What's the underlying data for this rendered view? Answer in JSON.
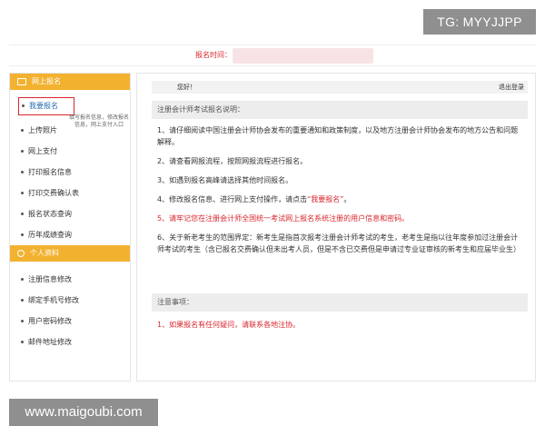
{
  "watermarks": {
    "top": "TG: MYYJJPP",
    "bottom": "www.maigoubi.com"
  },
  "header": {
    "registration_time_label": "报名时间："
  },
  "sidebar": {
    "section1": "网上报名",
    "items": [
      "我要报名",
      "上传照片",
      "网上支付",
      "打印报名信息",
      "打印交费确认表",
      "报名状态查询",
      "历年成绩查询"
    ],
    "tooltip": "填写报名信息，修改报名信息，网上支付入口",
    "section2": "个人资料",
    "items2": [
      "注册信息修改",
      "绑定手机号修改",
      "用户密码修改",
      "邮件地址修改"
    ]
  },
  "content": {
    "greeting": "您好！",
    "logout": "退出登录",
    "notice_title": "注册会计师考试报名说明：",
    "notices": [
      "1、请仔细阅读中国注册会计师协会发布的重要通知和政策制度，以及地方注册会计师协会发布的地方公告和问题解释。",
      "2、请查看网报流程，按照网报流程进行报名。",
      "3、如遇到报名高峰请选择其他时间报名。",
      "4、修改报名信息、进行网上支付操作，请点击",
      "5、请牢记您在注册会计师全国统一考试网上报名系统注册的用户信息和密码。",
      "6、关于新老考生的范围界定：新考生是指首次报考注册会计师考试的考生，老考生是指以往年度参加过注册会计师考试的考生（含已报名交费确认但未出考人员，但是不含已交费但是申请过专业证审核的新考生和应届毕业生）"
    ],
    "notice4_highlight": "“我要报名”",
    "notice4_end": "。",
    "attention_title": "注意事项：",
    "attention": "1、如果报名有任何疑问，请联系各地注协。"
  }
}
